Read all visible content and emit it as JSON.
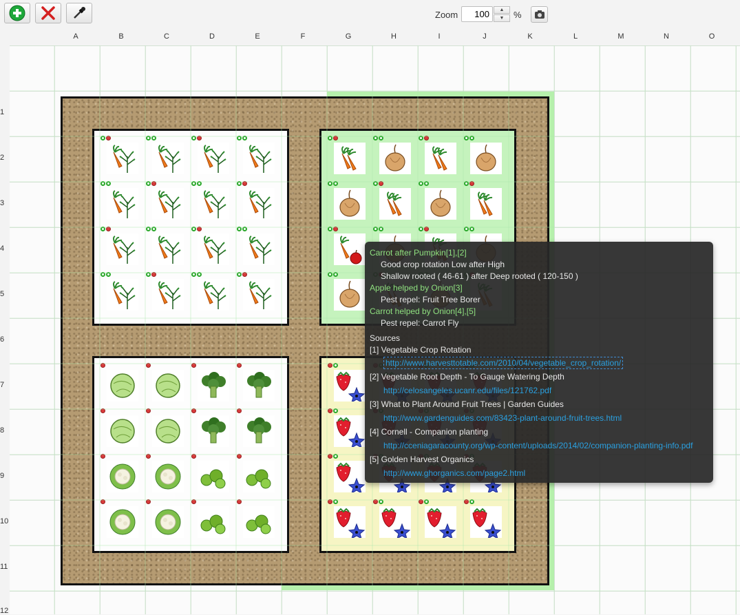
{
  "toolbar": {
    "add_icon": "plus-circle-icon",
    "delete_icon": "red-x-icon",
    "picker_icon": "eyedropper-icon",
    "zoom_label": "Zoom",
    "zoom_value": "100",
    "zoom_unit": "%",
    "camera_icon": "camera-icon"
  },
  "columns": [
    "A",
    "B",
    "C",
    "D",
    "E",
    "F",
    "G",
    "H",
    "I",
    "J",
    "K",
    "L",
    "M",
    "N",
    "O"
  ],
  "rows": [
    "1",
    "2",
    "3",
    "4",
    "5",
    "6",
    "7",
    "8",
    "9",
    "10",
    "11",
    "12"
  ],
  "colors": {
    "soil": "#b59b72",
    "companion_zone": "#b6f0ac",
    "bed_border": "#111111",
    "tooltip_bg": "#282828",
    "tooltip_heading": "#8fe07f",
    "tooltip_link": "#2aa0e0"
  },
  "beds": [
    {
      "name": "top-left-bed",
      "plants": [
        [
          "carrot-dill",
          "carrot-dill",
          "carrot-dill",
          "carrot-dill"
        ],
        [
          "carrot-dill",
          "carrot-dill",
          "carrot-dill",
          "carrot-dill"
        ],
        [
          "carrot-dill",
          "carrot-dill",
          "carrot-dill",
          "carrot-dill"
        ],
        [
          "carrot-dill",
          "carrot-dill",
          "carrot-dill",
          "carrot-dill"
        ]
      ]
    },
    {
      "name": "top-right-bed",
      "plants": [
        [
          "carrot",
          "onion",
          "carrot",
          "onion"
        ],
        [
          "onion",
          "carrot",
          "onion",
          "carrot"
        ],
        [
          "carrot-apple",
          "onion",
          "carrot",
          "onion"
        ],
        [
          "onion",
          "carrot",
          "onion",
          "carrot"
        ]
      ]
    },
    {
      "name": "bottom-left-bed",
      "plants": [
        [
          "cabbage",
          "cabbage",
          "broccoli",
          "broccoli"
        ],
        [
          "cabbage",
          "cabbage",
          "broccoli",
          "broccoli"
        ],
        [
          "cauliflower",
          "cauliflower",
          "brussels-sprouts",
          "brussels-sprouts"
        ],
        [
          "cauliflower",
          "cauliflower",
          "brussels-sprouts",
          "brussels-sprouts"
        ]
      ]
    },
    {
      "name": "bottom-right-bed",
      "plants": [
        [
          "strawberry-borage",
          "strawberry-borage",
          "strawberry-borage",
          "strawberry-borage"
        ],
        [
          "strawberry-borage",
          "strawberry-borage",
          "strawberry-borage",
          "strawberry-borage"
        ],
        [
          "strawberry-borage",
          "strawberry-borage",
          "strawberry-borage",
          "strawberry-borage"
        ],
        [
          "strawberry-borage",
          "strawberry-borage",
          "strawberry-borage",
          "strawberry-borage"
        ]
      ]
    }
  ],
  "tooltip": {
    "lines": [
      {
        "text": "Carrot after Pumpkin[1],[2]",
        "style": "heading"
      },
      {
        "text": "Good crop rotation Low after High",
        "style": "indent"
      },
      {
        "text": "Shallow rooted ( 46-61 ) after Deep rooted ( 120-150 )",
        "style": "indent"
      },
      {
        "text": "Apple helped by Onion[3]",
        "style": "heading"
      },
      {
        "text": "Pest repel: Fruit Tree Borer",
        "style": "indent"
      },
      {
        "text": "Carrot helped by Onion[4],[5]",
        "style": "heading"
      },
      {
        "text": "Pest repel: Carrot Fly",
        "style": "indent"
      }
    ],
    "sources_heading": "Sources",
    "sources": [
      {
        "title": "[1] Vegetable Crop Rotation",
        "url": "http://www.harvesttotable.com/2010/04/vegetable_crop_rotation/"
      },
      {
        "title": "[2] Vegetable Root Depth - To Gauge Watering Depth",
        "url": "http://celosangeles.ucanr.edu/files/121762.pdf"
      },
      {
        "title": "[3] What to Plant Around Fruit Trees | Garden Guides",
        "url": "http://www.gardenguides.com/83423-plant-around-fruit-trees.html"
      },
      {
        "title": "[4] Cornell - Companion planting",
        "url": "http://cceniagaracounty.org/wp-content/uploads/2014/02/companion-planting-info.pdf"
      },
      {
        "title": "[5] Golden Harvest Organics",
        "url": "http://www.ghorganics.com/page2.html"
      }
    ]
  }
}
